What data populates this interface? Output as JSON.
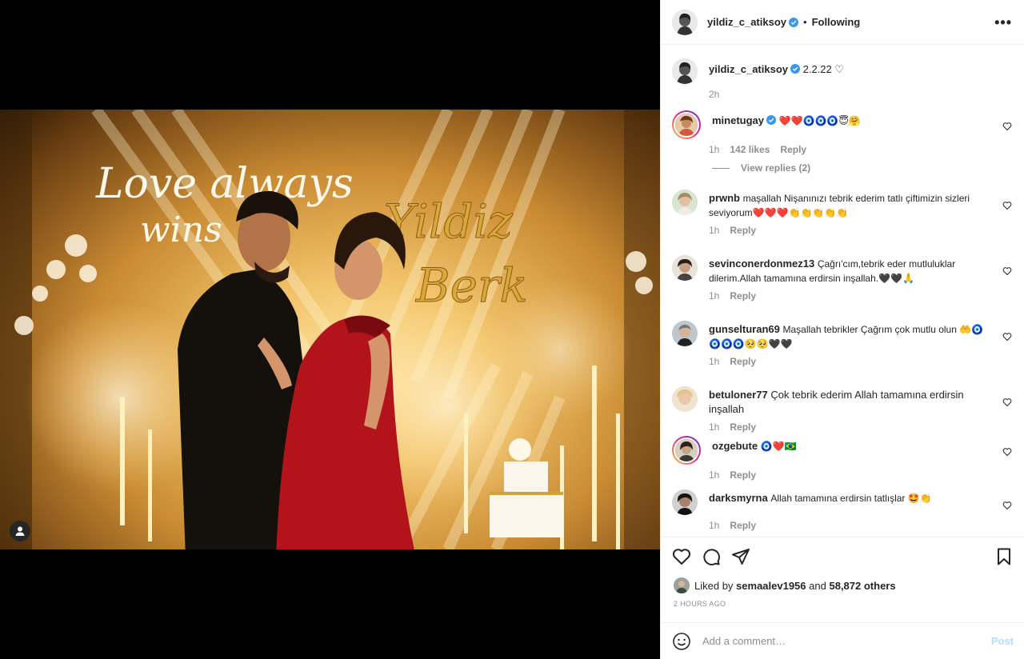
{
  "header": {
    "username": "yildiz_c_atiksoy",
    "separator": "•",
    "follow_state": "Following",
    "more_label": "•••"
  },
  "caption": {
    "username": "yildiz_c_atiksoy",
    "text": "2.2.22 ♡",
    "time": "2h"
  },
  "comments": [
    {
      "username": "minetugay",
      "verified": true,
      "text": "❤️❤️🧿🧿🧿😇🤗",
      "time": "1h",
      "likes": "142 likes",
      "reply": "Reply"
    },
    {
      "username": "prwnb",
      "text": "maşallah Nişanınızı tebrik ederim tatlı çiftimizin sizleri seviyorum❤️❤️❤️👏👏👏👏👏",
      "time": "1h",
      "reply": "Reply"
    },
    {
      "username": "sevinconerdonmez13",
      "text": "Çağrı'cım,tebrik eder mutluluklar dilerim.Allah tamamına erdirsin inşallah.🖤🖤🙏",
      "time": "1h",
      "reply": "Reply"
    },
    {
      "username": "gunselturan69",
      "text": "Maşallah tebrikler Çağrım çok mutlu olun 🤲🧿🧿🧿🧿🥺🥺🖤🖤",
      "time": "1h",
      "reply": "Reply"
    },
    {
      "username": "betuloner77",
      "text": "Çok tebrik ederim Allah tamamına erdirsin inşallah",
      "time": "1h",
      "reply": "Reply"
    },
    {
      "username": "ozgebute",
      "text": "🧿❤️🇧🇷",
      "time": "1h",
      "reply": "Reply"
    },
    {
      "username": "darksmyrna",
      "text": "Allah tamamına erdirsin tatlışlar 🤩👏",
      "time": "1h",
      "reply": "Reply"
    }
  ],
  "view_replies": "View replies (2)",
  "likes": {
    "prefix": "Liked by",
    "user": "semaalev1956",
    "middle": "and",
    "others": "58,872 others"
  },
  "timestamp": "2 HOURS AGO",
  "add_comment": {
    "placeholder": "Add a comment…",
    "post_label": "Post"
  },
  "colors": {
    "verified": "#3897f0",
    "post_button": "#b2dffc",
    "dress": "#b3141b"
  }
}
